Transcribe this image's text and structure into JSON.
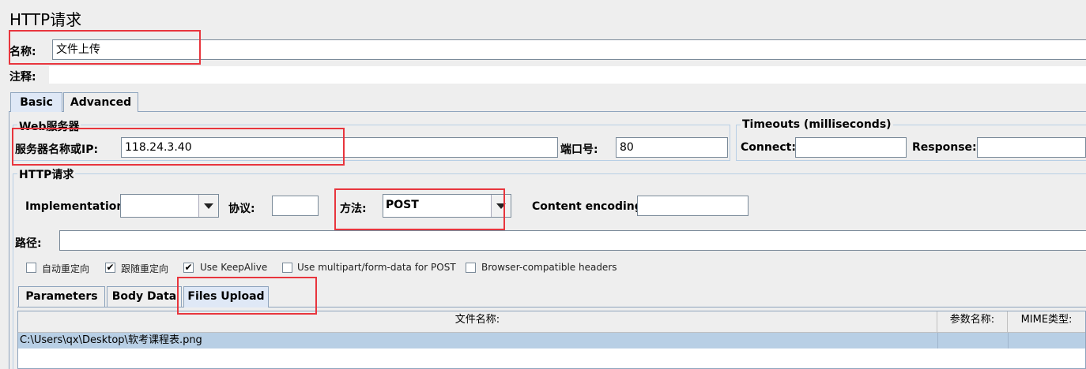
{
  "window": {
    "title": "HTTP请求"
  },
  "name": {
    "label": "名称:",
    "value": "文件上传"
  },
  "comment": {
    "label": "注释:",
    "value": ""
  },
  "tabs": [
    "Basic",
    "Advanced"
  ],
  "web_server": {
    "legend": "Web服务器",
    "server_label": "服务器名称或IP:",
    "server_value": "118.24.3.40",
    "port_label": "端口号:",
    "port_value": "80"
  },
  "timeouts": {
    "legend": "Timeouts (milliseconds)",
    "connect_label": "Connect:",
    "connect_value": "",
    "response_label": "Response:",
    "response_value": ""
  },
  "http_request": {
    "legend": "HTTP请求",
    "implementation_label": "Implementation:",
    "implementation_value": "",
    "protocol_label": "协议:",
    "protocol_value": "",
    "method_label": "方法:",
    "method_value": "POST",
    "encoding_label": "Content encoding:",
    "encoding_value": "",
    "path_label": "路径:",
    "path_value": ""
  },
  "options": [
    {
      "label": "自动重定向",
      "checked": false
    },
    {
      "label": "跟随重定向",
      "checked": true
    },
    {
      "label": "Use KeepAlive",
      "checked": true
    },
    {
      "label": "Use multipart/form-data for POST",
      "checked": false
    },
    {
      "label": "Browser-compatible headers",
      "checked": false
    }
  ],
  "subtabs": [
    "Parameters",
    "Body Data",
    "Files Upload"
  ],
  "files_table": {
    "headers": [
      "文件名称:",
      "参数名称:",
      "MIME类型:"
    ],
    "rows": [
      [
        "C:\\Users\\qx\\Desktop\\软考课程表.png",
        "",
        ""
      ]
    ]
  },
  "check_mark": "✔",
  "colors": {
    "highlight": "#e8353d",
    "selected_row": "#b8cfe5",
    "selected_tab": "#dfe8f6"
  }
}
